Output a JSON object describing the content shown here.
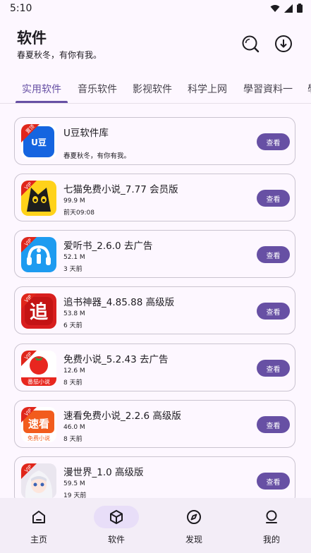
{
  "status": {
    "time": "5:10"
  },
  "header": {
    "title": "软件",
    "subtitle": "春夏秋冬，有你有我。"
  },
  "tabs": [
    {
      "label": "实用软件"
    },
    {
      "label": "音乐软件"
    },
    {
      "label": "影视软件"
    },
    {
      "label": "科学上网"
    },
    {
      "label": "學習資料一"
    },
    {
      "label": "學"
    }
  ],
  "apps": [
    {
      "name": "U豆软件库",
      "desc": "春夏秋冬，有你有我。",
      "button": "查看",
      "badge": "置顶",
      "logo_text": "U豆"
    },
    {
      "name": "七猫免费小说_7.77 会员版",
      "size": "99.9 M",
      "time": "前天09:08",
      "button": "查看",
      "badge": "VIP"
    },
    {
      "name": "爱听书_2.6.0 去广告",
      "size": "52.1 M",
      "time": "3 天前",
      "button": "查看",
      "badge": "VIP"
    },
    {
      "name": "追书神器_4.85.88 高级版",
      "size": "53.8 M",
      "time": "6 天前",
      "button": "查看",
      "badge": "VIP",
      "logo_text": "追"
    },
    {
      "name": "免费小说_5.2.43 去广告",
      "size": "12.6 M",
      "time": "8 天前",
      "button": "查看",
      "badge": "VIP",
      "logo_text": "番茄小说"
    },
    {
      "name": "速看免费小说_2.2.6 高级版",
      "size": "46.0 M",
      "time": "8 天前",
      "button": "查看",
      "badge": "VIP",
      "logo_text": "速看",
      "logo_sub": "免费小说"
    },
    {
      "name": "漫世界_1.0 高级版",
      "size": "59.5 M",
      "time": "19 天前",
      "button": "查看",
      "badge": "VIP"
    }
  ],
  "nav": [
    {
      "label": "主页",
      "icon": "home-icon"
    },
    {
      "label": "软件",
      "icon": "cube-icon"
    },
    {
      "label": "发现",
      "icon": "compass-icon"
    },
    {
      "label": "我的",
      "icon": "person-icon"
    }
  ],
  "colors": {
    "accent": "#6750a4",
    "background": "#fdf7ff",
    "nav_background": "#f3edf7",
    "active_pill": "#e8def8"
  }
}
